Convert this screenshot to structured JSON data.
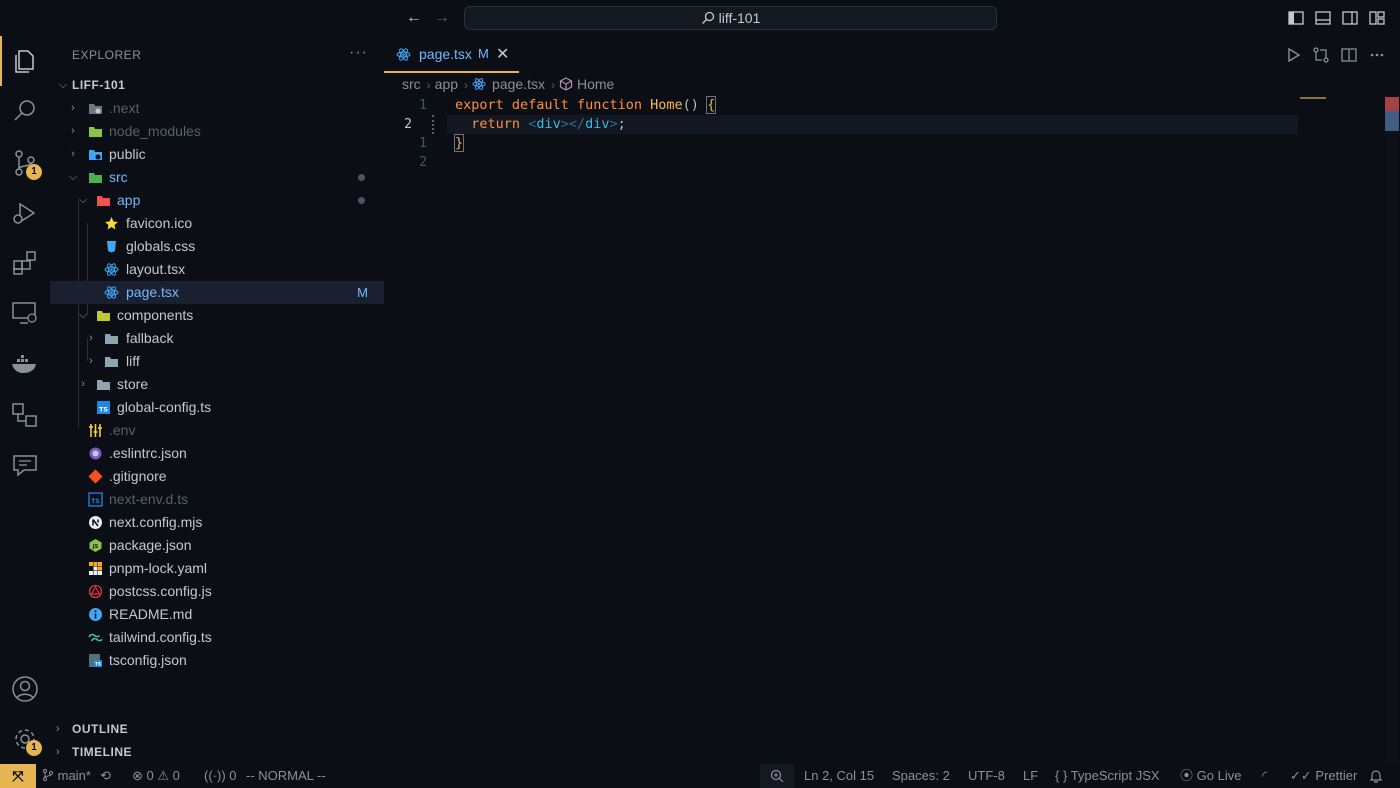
{
  "titlebar": {
    "search_text": "liff-101"
  },
  "activity": {
    "scm_badge": "1",
    "settings_badge": "1"
  },
  "explorer": {
    "title": "EXPLORER",
    "more": "···",
    "root": "LIFF-101",
    "items": [
      {
        "name": ".next",
        "dim": true
      },
      {
        "name": "node_modules",
        "dim": true
      },
      {
        "name": "public"
      },
      {
        "name": "src"
      },
      {
        "name": "app"
      },
      {
        "name": "favicon.ico"
      },
      {
        "name": "globals.css"
      },
      {
        "name": "layout.tsx"
      },
      {
        "name": "page.tsx",
        "status": "M"
      },
      {
        "name": "components"
      },
      {
        "name": "fallback"
      },
      {
        "name": "liff"
      },
      {
        "name": "store"
      },
      {
        "name": "global-config.ts"
      },
      {
        "name": ".env",
        "dim": true
      },
      {
        "name": ".eslintrc.json"
      },
      {
        "name": ".gitignore"
      },
      {
        "name": "next-env.d.ts",
        "dim": true
      },
      {
        "name": "next.config.mjs"
      },
      {
        "name": "package.json"
      },
      {
        "name": "pnpm-lock.yaml"
      },
      {
        "name": "postcss.config.js"
      },
      {
        "name": "README.md"
      },
      {
        "name": "tailwind.config.ts"
      },
      {
        "name": "tsconfig.json"
      }
    ],
    "outline_label": "OUTLINE",
    "timeline_label": "TIMELINE"
  },
  "editor": {
    "tab": {
      "label": "page.tsx",
      "status": "M",
      "close": "✕"
    },
    "breadcrumb": [
      "src",
      "app",
      "page.tsx",
      "Home"
    ],
    "line_numbers": [
      "1",
      "2",
      "1",
      "2"
    ],
    "code": {
      "l1": {
        "export": "export",
        "default": "default",
        "function": "function",
        "name": "Home",
        "parens": "()",
        "brace": "{"
      },
      "l2": {
        "return": "return",
        "open_lt": "<",
        "open_tag": "div",
        "open_gt": ">",
        "close_lt": "</",
        "close_tag": "div",
        "close_gt": ">",
        "semi": ";"
      },
      "l3": {
        "brace": "}"
      }
    }
  },
  "statusbar": {
    "remote": "⤧",
    "branch": "main*",
    "errors": "0",
    "warnings": "0",
    "ports": "0",
    "vim_mode": "-- NORMAL --",
    "position": "Ln 2, Col 15",
    "spaces": "Spaces: 2",
    "encoding": "UTF-8",
    "eol": "LF",
    "language": "TypeScript JSX",
    "golive": "Go Live",
    "prettier": "Prettier"
  },
  "colors": {
    "accent": "#e6b450",
    "background": "#0b0e14",
    "link": "#73b8ff"
  }
}
